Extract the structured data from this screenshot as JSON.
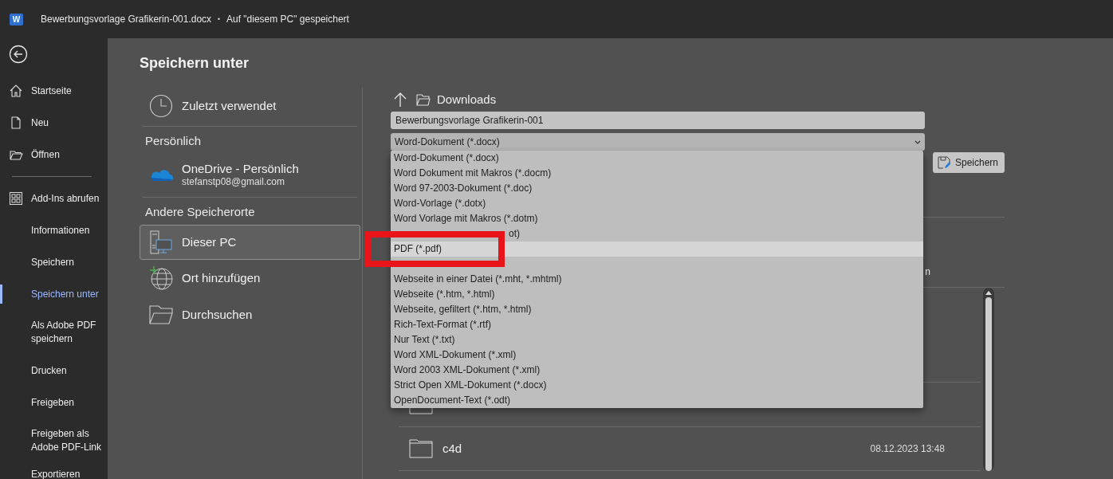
{
  "title_bar": {
    "app_letter": "W",
    "document_title": "Bewerbungsvorlage Grafikerin-001.docx",
    "separator": "▪",
    "save_status": "Auf \"diesem PC\" gespeichert"
  },
  "sidebar": {
    "items": [
      {
        "label": "Startseite",
        "selected": false
      },
      {
        "label": "Neu",
        "selected": false
      },
      {
        "label": "Öffnen",
        "selected": false
      },
      {
        "label": "Add-Ins abrufen",
        "selected": false
      },
      {
        "label": "Informationen",
        "selected": false
      },
      {
        "label": "Speichern",
        "selected": false
      },
      {
        "label": "Speichern unter",
        "selected": true
      },
      {
        "label": "Als Adobe PDF speichern",
        "selected": false
      },
      {
        "label": "Drucken",
        "selected": false
      },
      {
        "label": "Freigeben",
        "selected": false
      },
      {
        "label": "Freigeben als Adobe PDF-Link",
        "selected": false
      },
      {
        "label": "Exportieren",
        "selected": false
      }
    ]
  },
  "page_title": "Speichern unter",
  "locations": [
    {
      "kind": "location",
      "label": "Zuletzt verwendet",
      "selected": false
    },
    {
      "kind": "heading",
      "label": "Persönlich"
    },
    {
      "kind": "location",
      "label": "OneDrive - Persönlich",
      "subtitle": "stefanstp08@gmail.com",
      "selected": false
    },
    {
      "kind": "heading",
      "label": "Andere Speicherorte"
    },
    {
      "kind": "location",
      "label": "Dieser PC",
      "selected": true
    },
    {
      "kind": "location",
      "label": "Ort hinzufügen",
      "selected": false
    },
    {
      "kind": "location",
      "label": "Durchsuchen",
      "selected": false
    }
  ],
  "save_panel": {
    "folder": "Downloads",
    "file_name": "Bewerbungsvorlage Grafikerin-001",
    "file_type": "Word-Dokument (*.docx)",
    "save_button": "Speichern",
    "file_type_options": [
      {
        "kind": "option",
        "label": "Word-Dokument (*.docx)",
        "selected": false
      },
      {
        "kind": "option",
        "label": "Word Dokument mit Makros (*.docm)",
        "selected": false
      },
      {
        "kind": "option",
        "label": "Word 97-2003-Dokument (*.doc)",
        "selected": false
      },
      {
        "kind": "option",
        "label": "Word-Vorlage (*.dotx)",
        "selected": false
      },
      {
        "kind": "option",
        "label": "Word Vorlage mit Makros (*.dotm)",
        "selected": false
      },
      {
        "kind": "partial",
        "label": "ot)",
        "selected": false
      },
      {
        "kind": "option",
        "label": "PDF (*.pdf)",
        "selected": true
      },
      {
        "kind": "covered",
        "selected": false
      },
      {
        "kind": "option",
        "label": "Webseite in einer Datei (*.mht, *.mhtml)",
        "selected": false
      },
      {
        "kind": "option",
        "label": "Webseite (*.htm, *.html)",
        "selected": false
      },
      {
        "kind": "option",
        "label": "Webseite, gefiltert (*.htm, *.html)",
        "selected": false
      },
      {
        "kind": "option",
        "label": "Rich-Text-Format (*.rtf)",
        "selected": false
      },
      {
        "kind": "option",
        "label": "Nur Text (*.txt)",
        "selected": false
      },
      {
        "kind": "option",
        "label": "Word XML-Dokument (*.xml)",
        "selected": false
      },
      {
        "kind": "option",
        "label": "Word 2003 XML-Dokument (*.xml)",
        "selected": false
      },
      {
        "kind": "option",
        "label": "Strict Open XML-Dokument (*.docx)",
        "selected": false
      },
      {
        "kind": "option",
        "label": "OpenDocument-Text (*.odt)",
        "selected": false
      }
    ],
    "text_fragment": "n",
    "files": [
      {
        "kind": "folder"
      },
      {
        "kind": "folder",
        "name": "c4d",
        "modified": "08.12.2023 13:48"
      }
    ]
  },
  "annotation": {
    "kind": "highlight_frame",
    "color": "#e8141a"
  }
}
